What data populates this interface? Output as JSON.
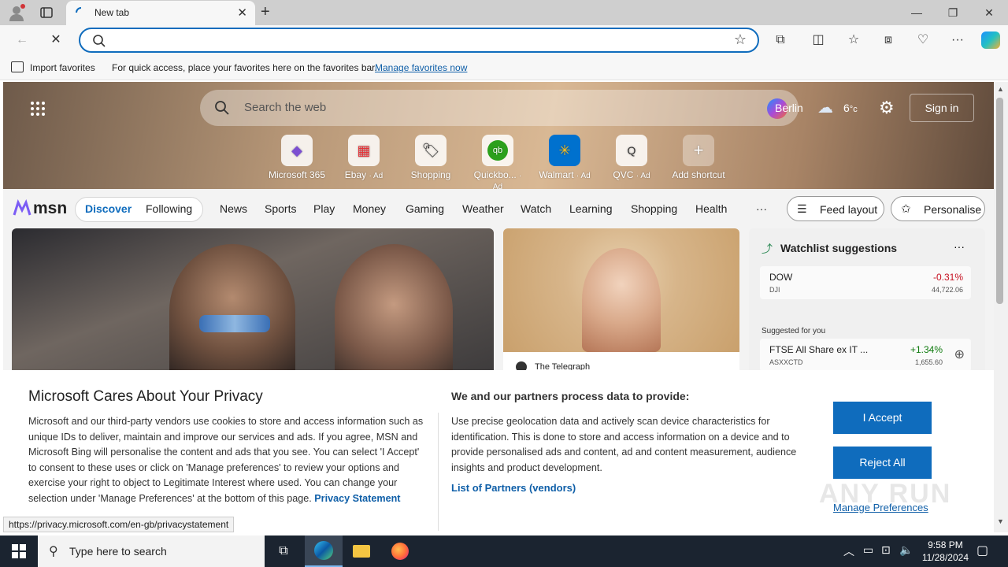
{
  "browser": {
    "tab_title": "New tab",
    "address_value": "",
    "favbar": {
      "import_label": "Import favorites",
      "message": "For quick access, place your favorites here on the favorites bar.",
      "manage_link": "Manage favorites now"
    }
  },
  "newtab": {
    "search_placeholder": "Search the web",
    "location": "Berlin",
    "temperature": "6",
    "temp_unit": "°c",
    "sign_in": "Sign in",
    "shortcuts": [
      {
        "label": "Microsoft 365",
        "ad": "",
        "icon": "microsoft365-icon"
      },
      {
        "label": "Ebay",
        "ad": "· Ad",
        "icon": "ebay-icon"
      },
      {
        "label": "Shopping",
        "ad": "",
        "icon": "shopping-tag-icon"
      },
      {
        "label": "Quickbo...",
        "ad": "· Ad",
        "icon": "quickbooks-icon"
      },
      {
        "label": "Walmart",
        "ad": "· Ad",
        "icon": "walmart-icon"
      },
      {
        "label": "QVC",
        "ad": "· Ad",
        "icon": "qvc-icon"
      },
      {
        "label": "Add shortcut",
        "ad": "",
        "icon": "plus-icon"
      }
    ],
    "brand": "msn",
    "nav": {
      "discover": "Discover",
      "following": "Following",
      "items": [
        "News",
        "Sports",
        "Play",
        "Money",
        "Gaming",
        "Weather",
        "Watch",
        "Learning",
        "Shopping",
        "Health"
      ],
      "more": "···",
      "feed_layout": "Feed layout",
      "personalise": "Personalise"
    },
    "card2_source": "The Telegraph",
    "watchlist": {
      "title": "Watchlist suggestions",
      "more": "···",
      "items": [
        {
          "name": "DOW",
          "symbol": "DJI",
          "change": "-0.31%",
          "value": "44,722.06",
          "color": "#c50f1f"
        }
      ],
      "suggested_label": "Suggested for you",
      "suggested": [
        {
          "name": "FTSE All Share ex IT ...",
          "symbol": "ASXXCTD",
          "change": "+1.34%",
          "value": "1,655.60",
          "color": "#0e7a0d"
        }
      ]
    }
  },
  "privacy": {
    "title": "Microsoft Cares About Your Privacy",
    "body": "Microsoft and our third-party vendors use cookies to store and access information such as unique IDs to deliver, maintain and improve our services and ads. If you agree, MSN and Microsoft Bing will personalise the content and ads that you see. You can select 'I Accept' to consent to these uses or click on 'Manage preferences' to review your options and exercise your right to object to Legitimate Interest where used.  You can change your selection under 'Manage Preferences' at the bottom of this page.",
    "privacy_link": "Privacy Statement",
    "process_title": "We and our partners process data to provide:",
    "process_body": "Use precise geolocation data and actively scan device characteristics for identification. This is done to store and access information on a device and to provide personalised ads and content, ad and content measurement, audience insights and product development.",
    "partners_link": "List of Partners (vendors)",
    "accept": "I Accept",
    "reject": "Reject All",
    "manage": "Manage Preferences"
  },
  "status_url": "https://privacy.microsoft.com/en-gb/privacystatement",
  "taskbar": {
    "search_placeholder": "Type here to search",
    "time": "9:58 PM",
    "date": "11/28/2024"
  },
  "watermark": "ANY RUN"
}
